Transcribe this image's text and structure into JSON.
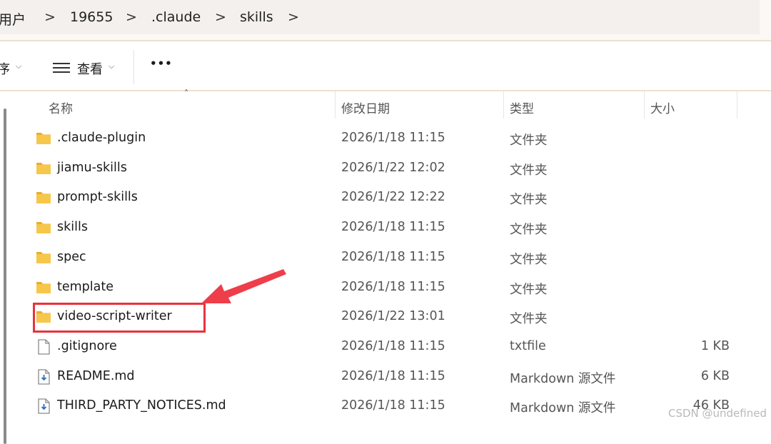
{
  "breadcrumb": {
    "items": [
      "用户",
      "19655",
      ".claude",
      "skills"
    ],
    "separator": ">"
  },
  "toolbar": {
    "sort_label": "序",
    "view_label": "查看",
    "more_label": "•••"
  },
  "columns": {
    "name": "名称",
    "modified": "修改日期",
    "type": "类型",
    "size": "大小"
  },
  "files": [
    {
      "name": ".claude-plugin",
      "modified": "2026/1/18 11:15",
      "type": "文件夹",
      "size": "",
      "icon": "folder-icon"
    },
    {
      "name": "jiamu-skills",
      "modified": "2026/1/22 12:02",
      "type": "文件夹",
      "size": "",
      "icon": "folder-icon"
    },
    {
      "name": "prompt-skills",
      "modified": "2026/1/22 12:22",
      "type": "文件夹",
      "size": "",
      "icon": "folder-icon"
    },
    {
      "name": "skills",
      "modified": "2026/1/18 11:15",
      "type": "文件夹",
      "size": "",
      "icon": "folder-icon"
    },
    {
      "name": "spec",
      "modified": "2026/1/18 11:15",
      "type": "文件夹",
      "size": "",
      "icon": "folder-icon"
    },
    {
      "name": "template",
      "modified": "2026/1/18 11:15",
      "type": "文件夹",
      "size": "",
      "icon": "folder-icon"
    },
    {
      "name": "video-script-writer",
      "modified": "2026/1/22 13:01",
      "type": "文件夹",
      "size": "",
      "icon": "folder-icon"
    },
    {
      "name": ".gitignore",
      "modified": "2026/1/18 11:15",
      "type": "txtfile",
      "size": "1 KB",
      "icon": "text-file-icon"
    },
    {
      "name": "README.md",
      "modified": "2026/1/18 11:15",
      "type": "Markdown 源文件",
      "size": "6 KB",
      "icon": "markdown-file-icon"
    },
    {
      "name": "THIRD_PARTY_NOTICES.md",
      "modified": "2026/1/18 11:15",
      "type": "Markdown 源文件",
      "size": "46 KB",
      "icon": "markdown-file-icon"
    }
  ],
  "highlighted_item": "video-script-writer",
  "watermark": "CSDN @undefined",
  "colors": {
    "folder": "#f6c74a",
    "highlight": "#e8323c",
    "arrow": "#ee3e4a"
  }
}
